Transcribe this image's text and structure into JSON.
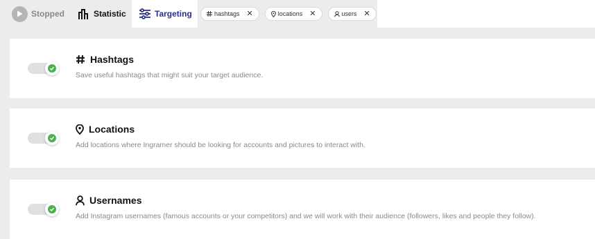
{
  "tabs": {
    "stopped": {
      "label": "Stopped",
      "icon": "play-icon"
    },
    "statistic": {
      "label": "Statistic",
      "icon": "bar-chart-icon"
    },
    "targeting": {
      "label": "Targeting",
      "icon": "sliders-icon",
      "active": true
    }
  },
  "chips": [
    {
      "label": "hashtags",
      "icon": "hash-icon",
      "close": "✕"
    },
    {
      "label": "locations",
      "icon": "location-pin-icon",
      "close": "✕"
    },
    {
      "label": "users",
      "icon": "user-icon",
      "close": "✕"
    }
  ],
  "sections": [
    {
      "title": "Hashtags",
      "icon": "hash-icon",
      "description": "Save useful hashtags that might suit your target audience.",
      "enabled": true
    },
    {
      "title": "Locations",
      "icon": "location-pin-icon",
      "description": "Add locations where Ingramer should be looking for accounts and pictures to interact with.",
      "enabled": true
    },
    {
      "title": "Usernames",
      "icon": "user-icon",
      "description": "Add Instagram usernames (famous accounts or your competitors) and we will work with their audience (followers, likes and people they follow).",
      "enabled": true
    }
  ],
  "colors": {
    "accent": "#2a2f8a",
    "toggle_on": "#4caf50",
    "background": "#ececec"
  }
}
